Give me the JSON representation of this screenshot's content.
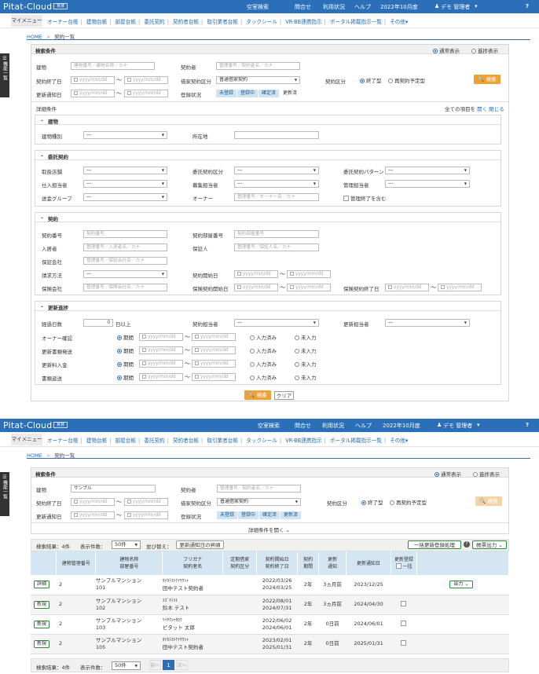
{
  "header": {
    "brand": "Pitat-Cloud",
    "brand_tag": "賃貸",
    "vacancy_search": "空室検索",
    "inquiry": "問合せ",
    "usage": "利用状況",
    "help": "ヘルプ",
    "period": "2022年10月度",
    "user": "デモ 管理者",
    "user_caret": "▾",
    "help_icon": "?"
  },
  "menubar": {
    "tab": "マイメニュー",
    "items": [
      "オーナー台帳",
      "建物台帳",
      "部屋台帳",
      "委託契約",
      "契約者台帳",
      "取引業者台帳",
      "タックシール",
      "VR-BB連携指示",
      "ポータル掲載指示一覧",
      "その他▾"
    ]
  },
  "breadcrumb": {
    "home": "HOME",
    "current": "契約一覧",
    "sep": ">"
  },
  "side_tab": "機能一覧",
  "search": {
    "title": "検索条件",
    "mode_normal": "通常表示",
    "mode_progress": "進捗表示",
    "building_label": "建物",
    "building_placeholder": "建物番号／建物名称／カナ",
    "building_value_2": "サンプル",
    "contractor_label": "契約者",
    "contractor_placeholder": "管理番号／契約者名／カナ",
    "end_date_label": "契約終了日",
    "date_placeholder": "yyyy/mm/dd",
    "tilde": "〜",
    "renewal_label": "借家契約区分",
    "renewal_value": "普通借家契約",
    "contract_type_label": "契約区分",
    "contract_type_opt1": "終了型",
    "contract_type_opt2": "再契約予定型",
    "search_button": "検索",
    "update_notice_label": "更新通知日",
    "register_status_label": "登録状況",
    "register_status": [
      "未登録",
      "登録中",
      "確定済",
      "更新済"
    ],
    "expand_link": "詳細条件を開く"
  },
  "detail": {
    "title": "詳細条件",
    "all_items": "全ての項目を",
    "open": "開く",
    "close": "閉じる",
    "building": {
      "title": "建物",
      "type_label": "建物種別",
      "type_value": "---",
      "location_label": "所在地"
    },
    "consign": {
      "title": "委託契約",
      "store_label": "取扱店舗",
      "store_value": "---",
      "consign_type_label": "委託契約区分",
      "consign_type_value": "---",
      "pattern_label": "委託契約パターン",
      "pattern_value": "---",
      "buyer_label": "仕入担当者",
      "buyer_value": "---",
      "recruit_label": "募集担当者",
      "recruit_value": "---",
      "manager_label": "管理担当者",
      "manager_value": "---",
      "remit_label": "送金グループ",
      "remit_value": "---",
      "owner_label": "オーナー",
      "owner_placeholder": "管理番号／オーナー名／カナ",
      "include_ended": "管理終了を含む"
    },
    "contract": {
      "title": "契約",
      "no_label": "契約番号",
      "no_placeholder": "契約番号",
      "room_no_label": "契約部屋番号",
      "room_no_placeholder": "契約部屋番号",
      "tenant_label": "入居者",
      "tenant_placeholder": "管理番号／入居者名／カナ",
      "guarantor_label": "保証人",
      "guarantor_placeholder": "管理番号／保証人名／カナ",
      "guarantee_co_label": "保証会社",
      "guarantee_co_placeholder": "管理番号／保証会社名／カナ",
      "billing_label": "請求方法",
      "billing_value": "---",
      "start_label": "契約開始日",
      "insurer_label": "保険会社",
      "insurer_placeholder": "管理番号／保険会社名／カナ",
      "ins_start_label": "保険契約開始日",
      "ins_end_label": "保険契約終了日"
    },
    "renewal": {
      "title": "更新進捗",
      "elapsed_label": "経過日数",
      "elapsed_value": "0",
      "elapsed_suffix": "日以上",
      "contract_mgr_label": "契約担当者",
      "contract_mgr_value": "---",
      "renewal_mgr_label": "更新担当者",
      "renewal_mgr_value": "---",
      "period": "期間",
      "entered": "入力済み",
      "not_entered": "未入力",
      "rows": [
        "オーナー確認",
        "更新書類発送",
        "更新料入金",
        "書類返送"
      ]
    },
    "search_button": "検索",
    "clear_button": "クリア"
  },
  "results": {
    "count_label": "検索結果：4件",
    "per_page_label": "表示件数：",
    "per_page_value": "50件",
    "sort_label": "並び替え：",
    "sort_value": "更新通知日の昇順",
    "bulk_button": "一括更新登録処理",
    "help_icon": "?",
    "export_button": "帳票出力",
    "headers": {
      "mgmt_no": "建物管理番号",
      "building": "建物名称",
      "room_no": "部屋番号",
      "kana": "フリガナ",
      "contractor": "契約者名",
      "fixed": "定期借家",
      "contract_cat": "契約区分",
      "start": "契約開始日",
      "end": "契約終了日",
      "term_a": "契約",
      "term_b": "期間",
      "notice_a": "更新",
      "notice_b": "通知",
      "notice_date": "更新通知日",
      "reg_a": "更新登録",
      "reg_b": "一括"
    },
    "rows": [
      {
        "status": "詳細",
        "mgmt": "2",
        "building": "サンプルマンション",
        "room": "101",
        "kana": "ﾀﾅｶﾃｽﾄｹｲﾔｸｼｬ",
        "name": "田中テスト契約者",
        "start": "2022/03/26",
        "end": "2024/03/25",
        "term": "2年",
        "notice": "3ヵ月前",
        "notice_date": "2023/12/25",
        "action": "出力"
      },
      {
        "status": "新規",
        "mgmt": "2",
        "building": "サンプルマンション",
        "room": "102",
        "kana": "ｽｽﾞｷﾃｽﾄ",
        "name": "鈴木 テスト",
        "start": "2022/08/01",
        "end": "2024/07/31",
        "term": "2年",
        "notice": "3ヵ月前",
        "notice_date": "2024/04/30",
        "action": ""
      },
      {
        "status": "新規",
        "mgmt": "2",
        "building": "サンプルマンション",
        "room": "103",
        "kana": "ｹｲﾔｸｼｬﾀﾛｳ",
        "name": "ピタット 太郎",
        "start": "2022/06/02",
        "end": "2024/06/01",
        "term": "2年",
        "notice": "0日前",
        "notice_date": "2024/06/01",
        "action": ""
      },
      {
        "status": "新規",
        "mgmt": "2",
        "building": "サンプルマンション",
        "room": "105",
        "kana": "ﾀﾅｶﾃｽﾄｹｲﾔｸｼｬ",
        "name": "田中テスト契約者",
        "start": "2023/02/01",
        "end": "2025/01/31",
        "term": "2年",
        "notice": "0日前",
        "notice_date": "2025/01/31",
        "action": ""
      }
    ],
    "pager": {
      "prev": "前へ",
      "current": "1",
      "next": "次へ"
    }
  },
  "colors": {
    "header_blue": "#2a6fb8",
    "accent_orange": "#f0a132",
    "table_head": "#d5e6f3"
  }
}
